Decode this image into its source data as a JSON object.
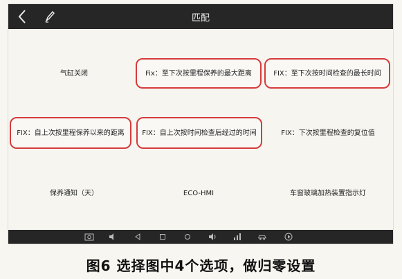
{
  "header": {
    "title": "匹配",
    "back_icon": "chevron-left-icon",
    "edit_icon": "pencil-icon"
  },
  "options": {
    "r1c1": "气缸关闭",
    "r1c2": "Fix：至下次按里程保养的最大距离",
    "r1c3": "FIX：至下次按时间检查的最长时间",
    "r2c1": "FIX：自上次按里程保养以来的距离",
    "r2c2": "FIX：自上次按时间检查后经过的时间",
    "r2c3": "FIX：下次按里程检查的复位值",
    "r3c1": "保养通知（天）",
    "r3c2": "ECO-HMI",
    "r3c3": "车窗玻璃加热装置指示灯"
  },
  "colors": {
    "highlight": "#d53b3b",
    "bar": "#262626"
  },
  "nav_icons": [
    "camera-icon",
    "volume-down-icon",
    "back-triangle-icon",
    "square-icon",
    "home-circle-icon",
    "volume-up-icon",
    "signal-icon",
    "car-icon",
    "play-icon"
  ],
  "caption": "图6 选择图中4个选项，做归零设置"
}
